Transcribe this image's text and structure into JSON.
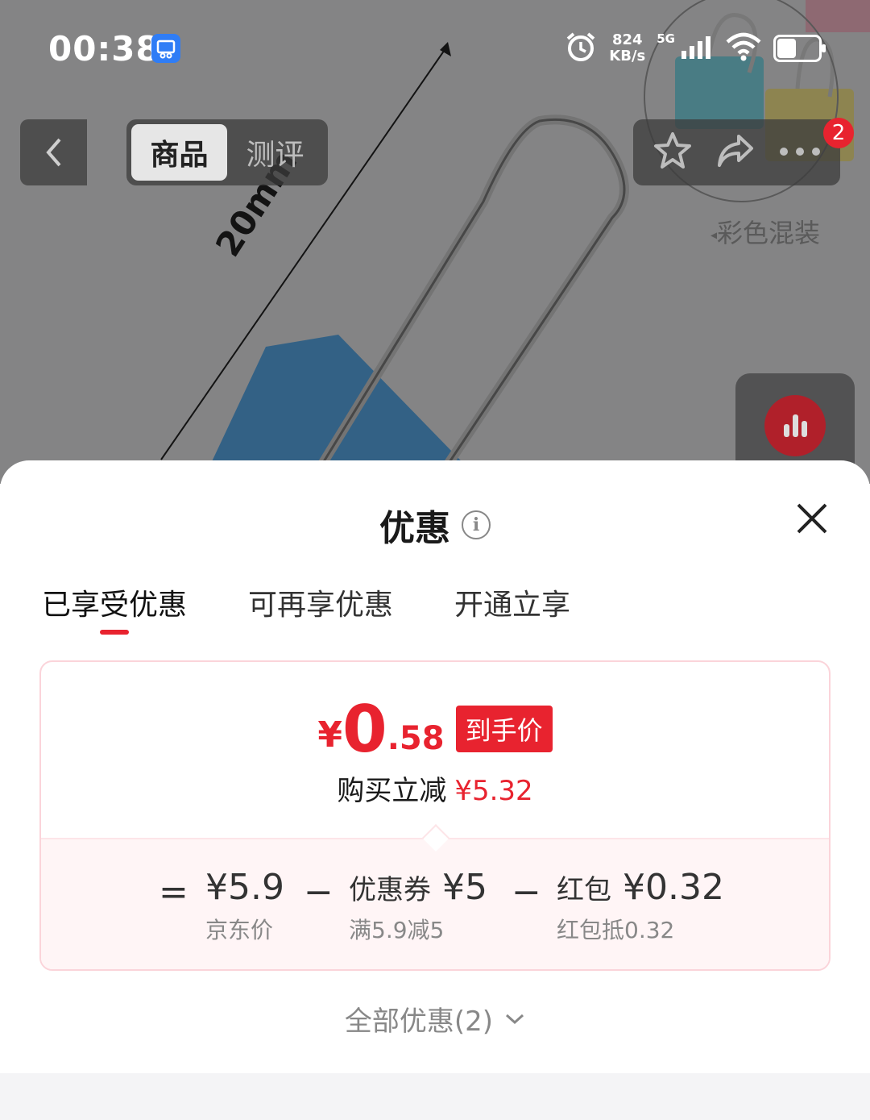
{
  "status_bar": {
    "time": "00:38",
    "net_speed_value": "824",
    "net_speed_unit": "KB/s",
    "signal_label": "5G",
    "battery_level": 0.45
  },
  "background": {
    "dimension_label": "20mm",
    "color_option_label": "彩色混装"
  },
  "nav": {
    "tabs": [
      {
        "label": "商品",
        "active": true
      },
      {
        "label": "测评",
        "active": false
      }
    ],
    "badge_count": "2"
  },
  "sheet": {
    "title": "优惠",
    "tabs": [
      {
        "label": "已享受优惠",
        "active": true
      },
      {
        "label": "可再享优惠",
        "active": false
      },
      {
        "label": "开通立享",
        "active": false
      }
    ],
    "price": {
      "currency": "¥",
      "integer": "0",
      "decimal": ".58",
      "tag": "到手价"
    },
    "reduce": {
      "label": "购买立减",
      "amount": "¥5.32"
    },
    "breakdown": {
      "equals": "=",
      "minus": "−",
      "items": [
        {
          "label": "",
          "value": "¥5.9",
          "sub": "京东价"
        },
        {
          "label": "优惠券",
          "value": "¥5",
          "sub": "满5.9减5"
        },
        {
          "label": "红包",
          "value": "¥0.32",
          "sub": "红包抵0.32"
        }
      ]
    },
    "all_discounts": "全部优惠(2)"
  },
  "colors": {
    "accent_red": "#e8232f",
    "card_border": "#fbd4da",
    "breakdown_bg": "#fff5f6"
  }
}
